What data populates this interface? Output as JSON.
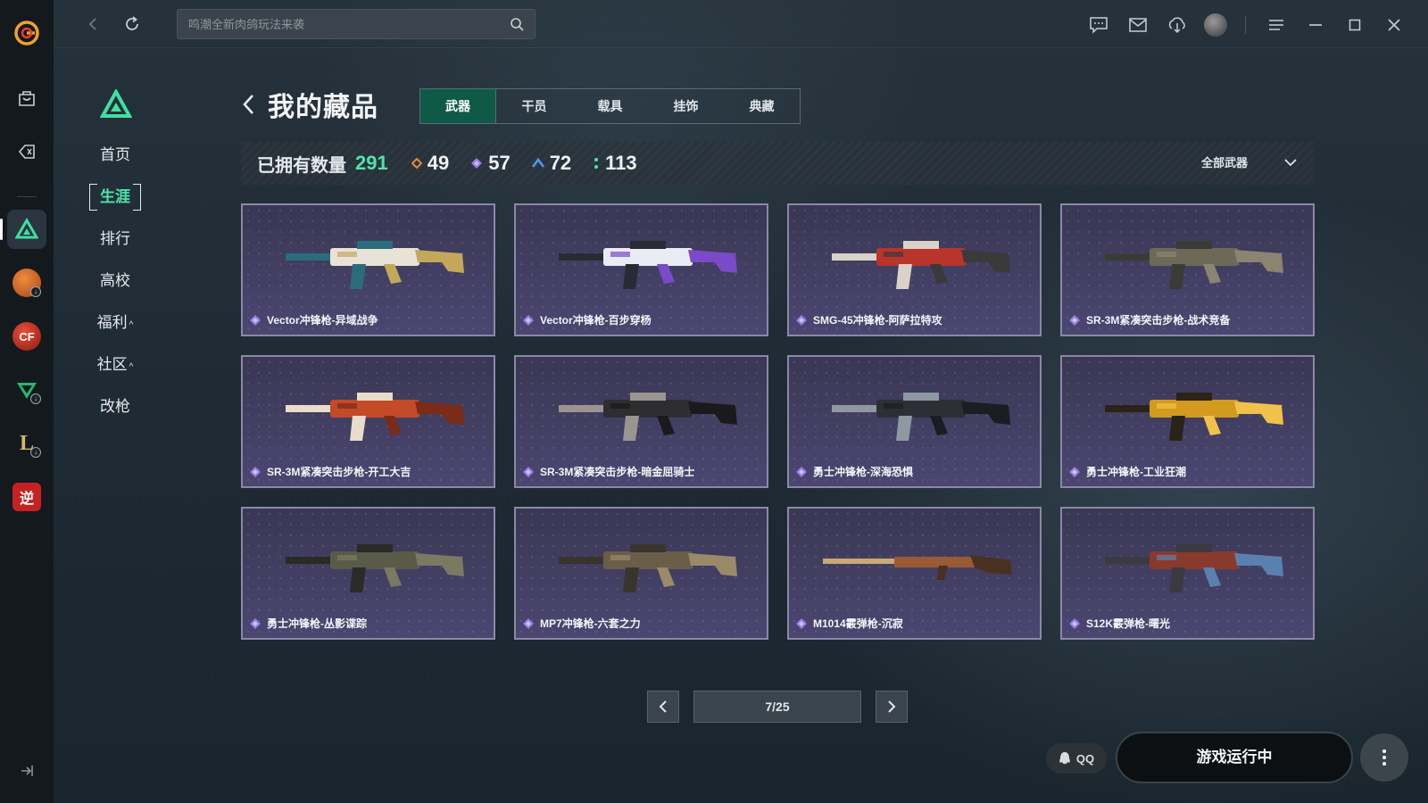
{
  "search": {
    "placeholder": "鸣潮全新肉鸽玩法来袭"
  },
  "subnav": {
    "items": [
      {
        "label": "首页",
        "expandable": false
      },
      {
        "label": "生涯",
        "active": true,
        "expandable": false
      },
      {
        "label": "排行",
        "expandable": false
      },
      {
        "label": "高校",
        "expandable": false
      },
      {
        "label": "福利",
        "expandable": true
      },
      {
        "label": "社区",
        "expandable": true
      },
      {
        "label": "改枪",
        "expandable": false
      }
    ]
  },
  "page": {
    "title": "我的藏品"
  },
  "tabs": [
    {
      "label": "武器",
      "active": true
    },
    {
      "label": "干员"
    },
    {
      "label": "载具"
    },
    {
      "label": "挂饰"
    },
    {
      "label": "典藏"
    }
  ],
  "stats": {
    "owned_label": "已拥有数量",
    "owned_total": "291",
    "rarity": [
      {
        "color": "#e6883a",
        "value": "49"
      },
      {
        "color": "#9b7be8",
        "value": "57"
      },
      {
        "color": "#4c9be6",
        "value": "72"
      },
      {
        "color": "#4ee4a8",
        "value": "113"
      }
    ],
    "filter_label": "全部武器"
  },
  "items": [
    {
      "name": "Vector冲锋枪-异域战争",
      "palette": [
        "#e8e3d6",
        "#2a6c7c",
        "#c4a85a"
      ]
    },
    {
      "name": "Vector冲锋枪-百步穿杨",
      "palette": [
        "#e9ecf2",
        "#2a2a35",
        "#7b4ac8"
      ]
    },
    {
      "name": "SMG-45冲锋枪-阿萨拉特攻",
      "palette": [
        "#b9342a",
        "#d9d2c8",
        "#3a3a3a"
      ]
    },
    {
      "name": "SR-3M紧凑突击步枪-战术竞备",
      "palette": [
        "#6e6858",
        "#3b3b36",
        "#8a8470"
      ]
    },
    {
      "name": "SR-3M紧凑突击步枪-开工大吉",
      "palette": [
        "#c44a28",
        "#e8dccb",
        "#7a2c18"
      ]
    },
    {
      "name": "SR-3M紧凑突击步枪-暗金屈骑士",
      "palette": [
        "#2e2e30",
        "#9a9590",
        "#1a1a1c"
      ]
    },
    {
      "name": "勇士冲锋枪-深海恐惧",
      "palette": [
        "#2c3036",
        "#8e98a0",
        "#1a1d21"
      ]
    },
    {
      "name": "勇士冲锋枪-工业狂潮",
      "palette": [
        "#d29a1e",
        "#2a2418",
        "#f0c24a"
      ]
    },
    {
      "name": "勇士冲锋枪-丛影谍踪",
      "palette": [
        "#5a5a48",
        "#2a2a26",
        "#7a7a62"
      ]
    },
    {
      "name": "MP7冲锋枪-六套之力",
      "palette": [
        "#6a5e48",
        "#3a352c",
        "#9a8a68"
      ]
    },
    {
      "name": "M1014霰弹枪-沉寂",
      "palette": [
        "#9a5a34",
        "#c9a878",
        "#4a3020"
      ]
    },
    {
      "name": "S12K霰弹枪-曙光",
      "palette": [
        "#8a3a2c",
        "#3a3a40",
        "#5a80b0"
      ]
    }
  ],
  "pagination": {
    "current": "7/25"
  },
  "bottom": {
    "qq_label": "QQ",
    "status_button": "游戏运行中"
  },
  "rail_games": [
    {
      "icon": "basketball-game-icon",
      "color": "#d46a2a"
    },
    {
      "icon": "crossfire-game-icon",
      "color": "#c8321e"
    },
    {
      "icon": "valorant-game-icon",
      "color": "#2ab86a"
    },
    {
      "icon": "league-game-icon",
      "color": "#b89a4a"
    },
    {
      "icon": "ni-game-icon",
      "color": "#d42a2a",
      "label": "逆"
    }
  ]
}
